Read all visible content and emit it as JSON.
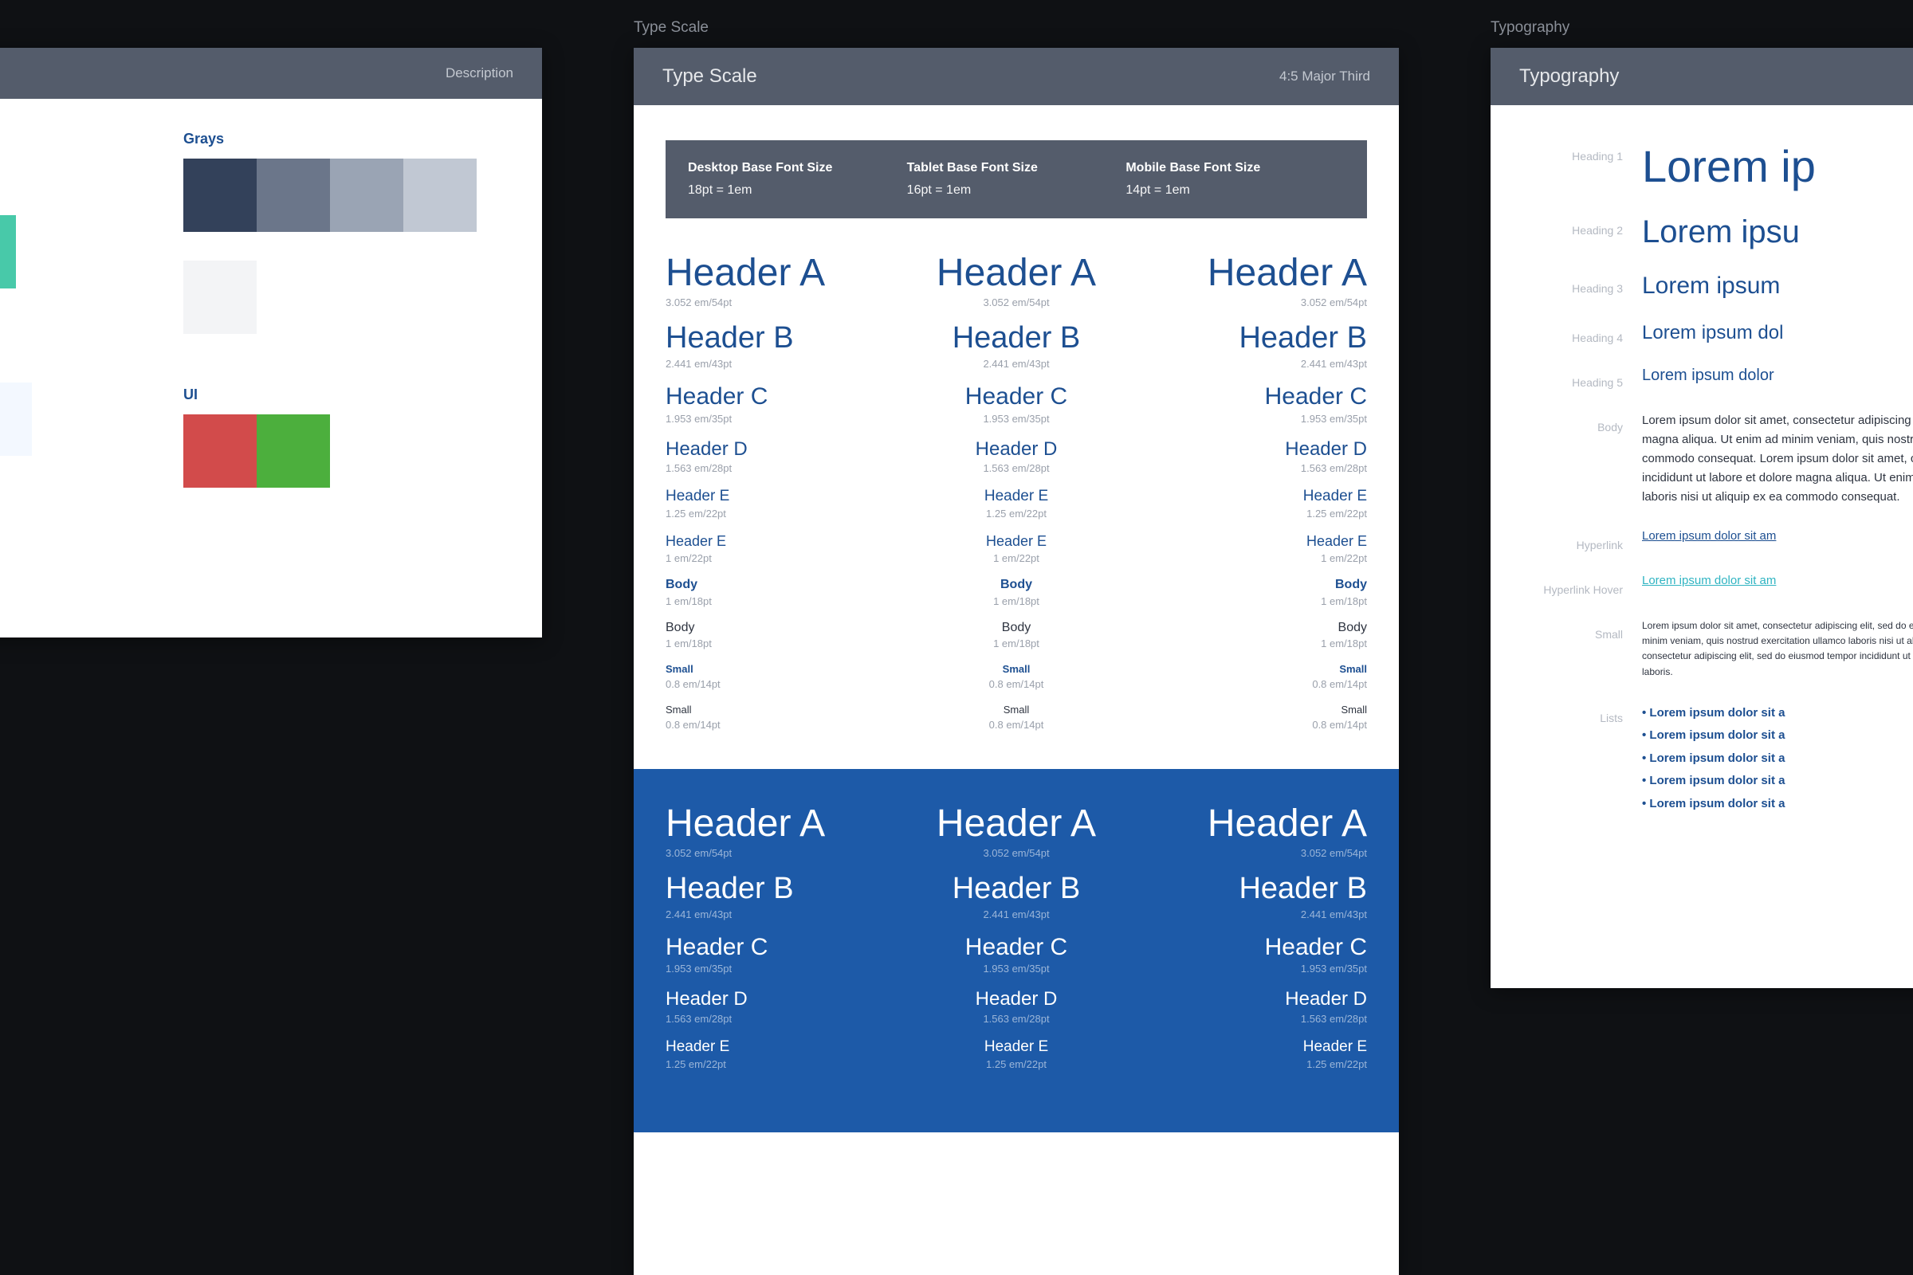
{
  "artboards": {
    "description": {
      "label": "",
      "header_right": "Description",
      "sections": {
        "grays": {
          "label": "Grays",
          "row1": [
            "#33415a",
            "#6b768a",
            "#9aa4b4",
            "#c1c8d3"
          ],
          "row2": [
            "#f3f4f6"
          ]
        },
        "ui": {
          "label": "UI",
          "row1": [
            "#d24b4b",
            "#4caf3d"
          ]
        },
        "teal_stripe": "#48c9a9",
        "pale_blue": "#f3f8ff"
      }
    },
    "typescale": {
      "label": "Type Scale",
      "title": "Type Scale",
      "ratio": "4:5 Major Third",
      "basebar": [
        {
          "label": "Desktop Base Font Size",
          "value": "18pt = 1em"
        },
        {
          "label": "Tablet Base Font Size",
          "value": "16pt = 1em"
        },
        {
          "label": "Mobile Base Font Size",
          "value": "14pt = 1em"
        }
      ],
      "entries": [
        {
          "name": "Header A",
          "sub": "3.052 em/54pt",
          "cls": "ha"
        },
        {
          "name": "Header B",
          "sub": "2.441 em/43pt",
          "cls": "hb"
        },
        {
          "name": "Header C",
          "sub": "1.953 em/35pt",
          "cls": "hc"
        },
        {
          "name": "Header D",
          "sub": "1.563 em/28pt",
          "cls": "hd"
        },
        {
          "name": "Header E",
          "sub": "1.25 em/22pt",
          "cls": "he"
        },
        {
          "name": "Header E",
          "sub": "1 em/22pt",
          "cls": "hf"
        },
        {
          "name": "Body",
          "sub": "1 em/18pt",
          "cls": "bd-b"
        },
        {
          "name": "Body",
          "sub": "1 em/18pt",
          "cls": "bd"
        },
        {
          "name": "Small",
          "sub": "0.8 em/14pt",
          "cls": "sm-b"
        },
        {
          "name": "Small",
          "sub": "0.8 em/14pt",
          "cls": "sm"
        }
      ],
      "dark_entries": [
        {
          "name": "Header A",
          "sub": "3.052 em/54pt",
          "cls": "ha"
        },
        {
          "name": "Header B",
          "sub": "2.441 em/43pt",
          "cls": "hb"
        },
        {
          "name": "Header C",
          "sub": "1.953 em/35pt",
          "cls": "hc"
        },
        {
          "name": "Header D",
          "sub": "1.563 em/28pt",
          "cls": "hd"
        },
        {
          "name": "Header E",
          "sub": "1.25 em/22pt",
          "cls": "he"
        }
      ]
    },
    "typography": {
      "label": "Typography",
      "title": "Typography",
      "rows": [
        {
          "label": "Heading 1",
          "text": "Lorem ip",
          "cls": "typo-h1"
        },
        {
          "label": "Heading 2",
          "text": "Lorem ipsu",
          "cls": "typo-h2"
        },
        {
          "label": "Heading 3",
          "text": "Lorem ipsum",
          "cls": "typo-h3"
        },
        {
          "label": "Heading 4",
          "text": "Lorem ipsum dol",
          "cls": "typo-h4"
        },
        {
          "label": "Heading 5",
          "text": "Lorem ipsum dolor",
          "cls": "typo-h5"
        }
      ],
      "body_label": "Body",
      "body_text": "Lorem ipsum dolor sit amet, consectetur adipiscing elit, sed do eiusmod tempor incididunt ut labore et dolore magna aliqua. Ut enim ad minim veniam, quis nostrud exercitation ullamco laboris nisi ut aliquip ex ea commodo consequat. Lorem ipsum dolor sit amet, consectetur adipiscing elit, sed do eiusmod tempor incididunt ut labore et dolore magna aliqua. Ut enim ad minim veniam, quis nostrud exercitation ullamco laboris nisi ut aliquip ex ea commodo consequat.",
      "hyperlink_label": "Hyperlink",
      "hyperlink_text": "Lorem ipsum dolor sit am",
      "hyperlink_hover_label": "Hyperlink Hover",
      "hyperlink_hover_text": "Lorem ipsum dolor sit am",
      "small_label": "Small",
      "small_text": "Lorem ipsum dolor sit amet, consectetur adipiscing elit, sed do eiusmod tempor incididunt ut labore et dolore magna aliqua. Ut enim ad minim veniam, quis nostrud exercitation ullamco laboris nisi ut aliquip ex ea commodo consequat. Lorem ipsum dolor sit amet, consectetur adipiscing elit, sed do eiusmod tempor incididunt ut labore et dolore magna aliqua. Quis nostrud exercitation ullamco laboris.",
      "lists_label": "Lists",
      "lists": [
        "Lorem ipsum dolor sit a",
        "Lorem ipsum dolor sit a",
        "Lorem ipsum dolor sit a",
        "Lorem ipsum dolor sit a",
        "Lorem ipsum dolor sit a"
      ]
    }
  }
}
